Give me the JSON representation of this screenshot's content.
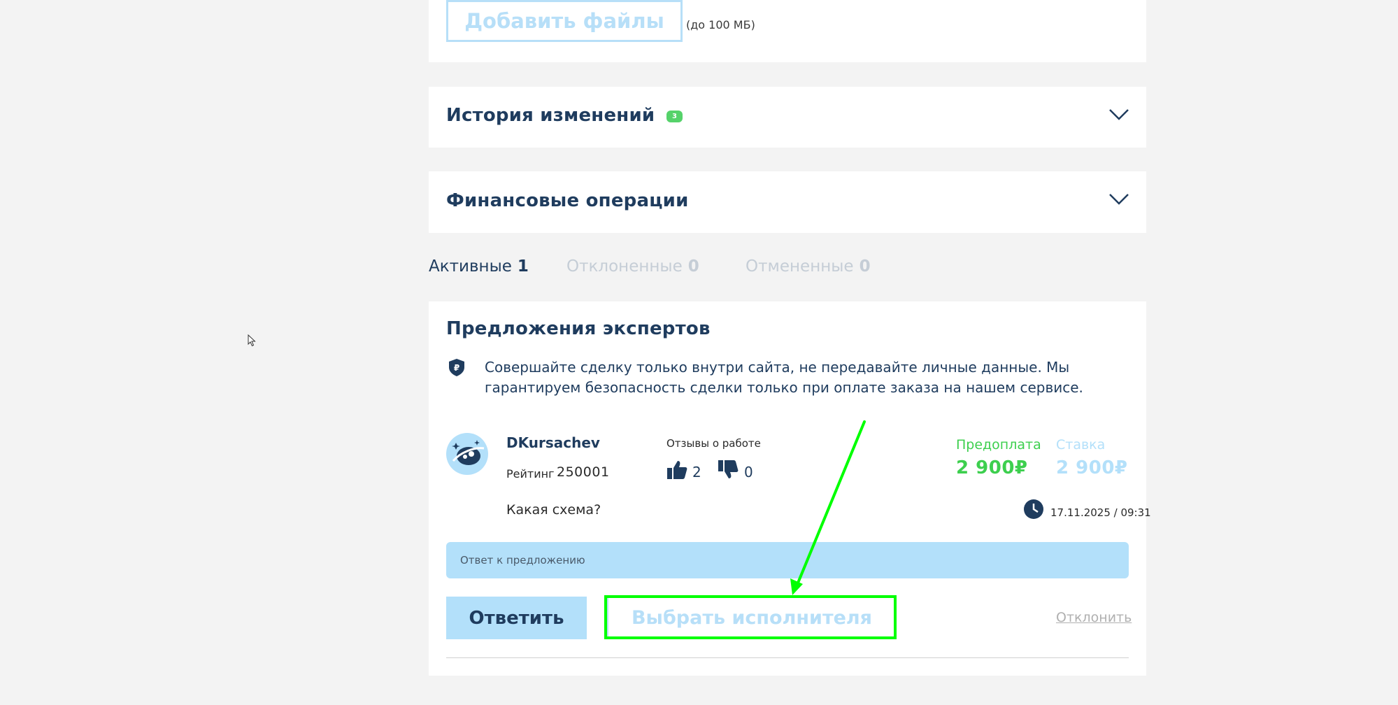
{
  "files": {
    "add_label": "Добавить файлы",
    "limit": "(до 100 МБ)"
  },
  "history": {
    "title": "История изменений",
    "badge": "3"
  },
  "finance": {
    "title": "Финансовые операции"
  },
  "tabs": [
    {
      "label": "Активные",
      "count": "1",
      "color": "#1f3c5e"
    },
    {
      "label": "Отклоненные",
      "count": "0",
      "color": "#c5cdd6"
    },
    {
      "label": "Отмененные",
      "count": "0",
      "color": "#c5cdd6"
    }
  ],
  "offers": {
    "title": "Предложения экспертов",
    "safety_text": "Совершайте сделку только внутри сайта, не передавайте личные данные. Мы гарантируем безопасность сделки только при оплате заказа на нашем сервисе.",
    "expert": {
      "name": "DKursachev",
      "rating_label": "Рейтинг",
      "rating_value": "250001",
      "reviews_title": "Отзывы о работе",
      "likes": "2",
      "dislikes": "0",
      "prepay_label": "Предоплата",
      "prepay_value": "2 900₽",
      "rate_label": "Ставка",
      "rate_value": "2 900₽",
      "message": "Какая схема?",
      "timestamp": "17.11.2025 / 09:31"
    },
    "reply_placeholder": "Ответ к предложению",
    "reply_button": "Ответить",
    "choose_button": "Выбрать исполнителя",
    "decline_link": "Отклонить"
  },
  "colors": {
    "accent_green": "#3dcf4e",
    "light_blue": "#b3e0fa",
    "navy": "#1f3c5e",
    "annotation": "#00ff00"
  }
}
